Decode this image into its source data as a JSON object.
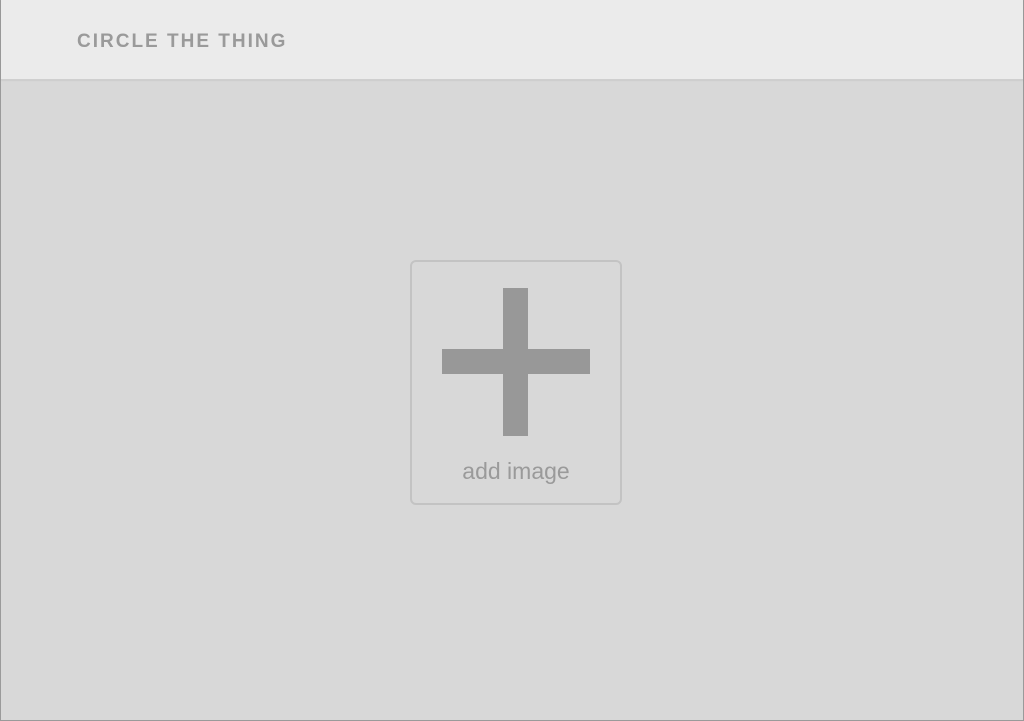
{
  "app": {
    "title": "CIRCLE THE THING"
  },
  "upload": {
    "icon": "plus-icon",
    "label": "add image"
  },
  "colors": {
    "header_bg": "#ebebeb",
    "canvas_bg": "#d8d8d8",
    "text_muted": "#9a9a9a",
    "icon": "#989898",
    "card_border": "#c3c3c3"
  }
}
